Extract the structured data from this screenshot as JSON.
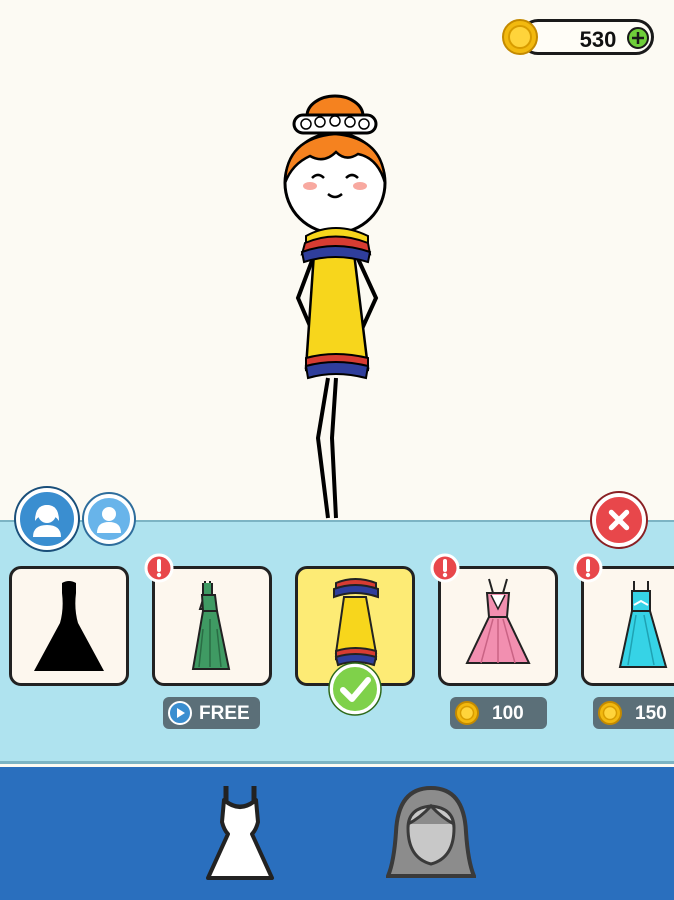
{
  "hud": {
    "coins": "530",
    "coin_icon": "gold-coin-icon",
    "add_icon": "plus-icon"
  },
  "tabs": [
    {
      "name": "female-character-tab",
      "icon": "female-avatar-icon",
      "active": true
    },
    {
      "name": "male-character-tab",
      "icon": "male-avatar-icon",
      "active": false
    }
  ],
  "close_icon": "close-x-icon",
  "outfits": [
    {
      "name": "outfit-black-gown",
      "color": "#000000",
      "state": "owned"
    },
    {
      "name": "outfit-green-dress",
      "color": "#3f9a63",
      "state": "new",
      "price_label": "FREE",
      "price_icon": "play-video-icon"
    },
    {
      "name": "outfit-yellow-dress",
      "color": "#f7d61c",
      "state": "equipped"
    },
    {
      "name": "outfit-pink-dress",
      "color": "#f28fb0",
      "state": "new",
      "price_label": "100",
      "price_icon": "gold-coin-icon"
    },
    {
      "name": "outfit-cyan-dress",
      "color": "#36d3e6",
      "state": "new",
      "price_label": "150",
      "price_icon": "gold-coin-icon"
    }
  ],
  "colors": {
    "background": "#fcfaf3",
    "tray": "#afe3ef",
    "bottom_bar": "#2a6fbe",
    "hair": "#f5821f",
    "dress": "#f7d61c"
  },
  "bottom_nav": [
    {
      "name": "clothes-category",
      "icon": "dress-icon",
      "active": true
    },
    {
      "name": "hair-category",
      "icon": "hairstyle-icon",
      "active": false
    }
  ]
}
